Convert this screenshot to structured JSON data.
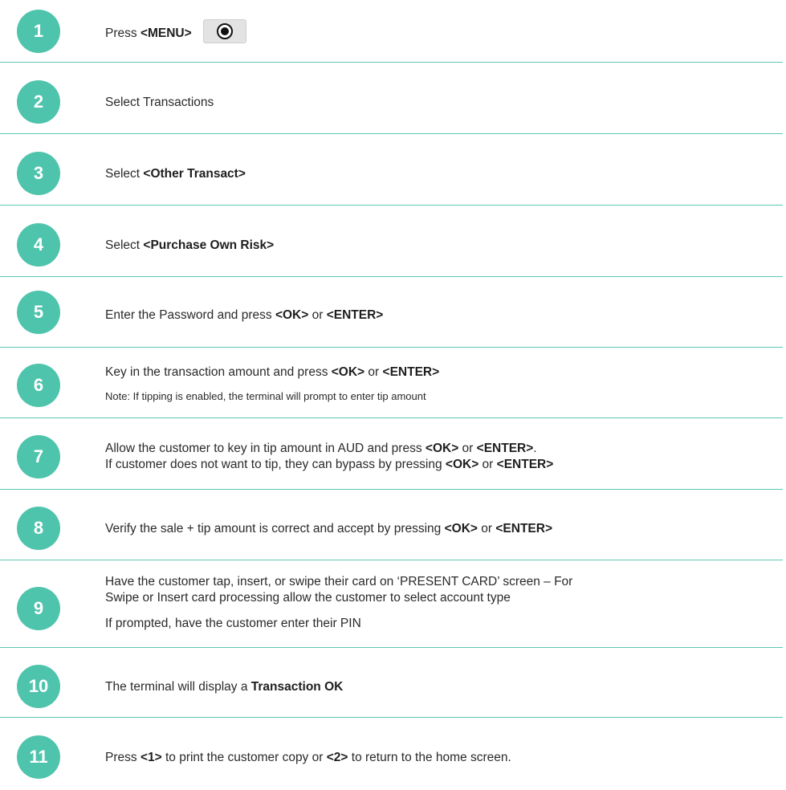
{
  "steps": [
    {
      "number": "1",
      "parts": [
        [
          "Press ",
          "<MENU>"
        ]
      ]
    },
    {
      "number": "2",
      "text": "Select Transactions"
    },
    {
      "number": "3",
      "parts": [
        [
          "Select ",
          "<Other Transact>"
        ]
      ]
    },
    {
      "number": "4",
      "parts": [
        [
          "Select ",
          "<Purchase Own Risk>"
        ]
      ]
    },
    {
      "number": "5",
      "parts": [
        [
          "Enter the Password and press ",
          "<OK>",
          " or ",
          "<ENTER>"
        ]
      ]
    },
    {
      "number": "6",
      "parts": [
        [
          "Key in the transaction amount and press ",
          "<OK>",
          " or ",
          "<ENTER>"
        ]
      ],
      "note": "Note: If tipping is enabled, the terminal will prompt to enter tip amount"
    },
    {
      "number": "7",
      "parts": [
        [
          "Allow the customer to key in tip amount in AUD and press ",
          "<OK>",
          " or ",
          "<ENTER>",
          "."
        ],
        [
          "If customer does not want to tip, they can bypass by pressing ",
          "<OK>",
          " or ",
          "<ENTER>"
        ]
      ]
    },
    {
      "number": "8",
      "parts": [
        [
          "Verify the sale + tip amount is correct and accept by pressing ",
          "<OK>",
          " or ",
          "<ENTER>"
        ]
      ]
    },
    {
      "number": "9",
      "lines": [
        "Have the customer tap, insert, or swipe their card on ‘PRESENT CARD’ screen – For",
        "Swipe or Insert card processing allow the customer to select account type"
      ],
      "extra": "If prompted, have the customer enter their PIN"
    },
    {
      "number": "10",
      "parts": [
        [
          "The terminal will display a ",
          "Transaction OK"
        ]
      ]
    },
    {
      "number": "11",
      "parts": [
        [
          "Press ",
          "<1>",
          " to print the customer copy or ",
          "<2>",
          " to return to the home screen."
        ]
      ]
    }
  ],
  "icons": {
    "menu_key": "menu-key-icon"
  },
  "colors": {
    "accent": "#4ec4ac",
    "divider": "#5ec7b2"
  }
}
